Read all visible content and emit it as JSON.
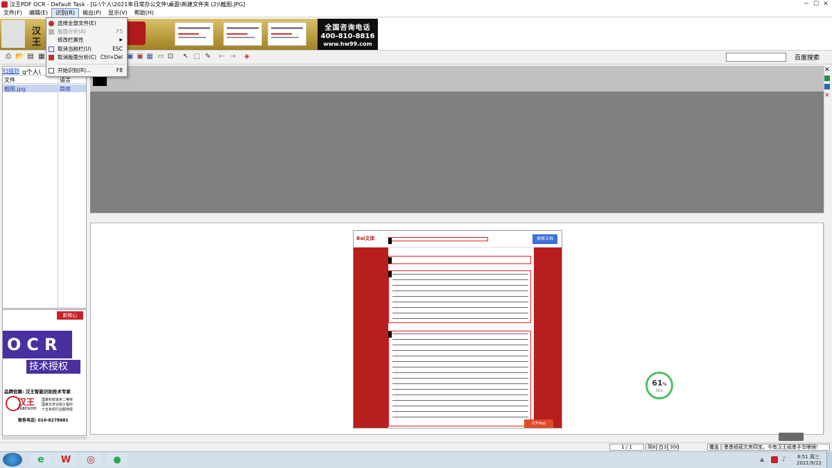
{
  "app": {
    "title": "汉王PDF OCR - Default Task - [G:\\个人\\2021年日常办公文件\\桌面\\新建文件夹 (2)\\截图.JPG]"
  },
  "menubar": {
    "file": "文件(F)",
    "edit": "编辑(E)",
    "recognize": "识别(R)",
    "output": "输出(P)",
    "display": "显示(V)",
    "help": "帮助(H)"
  },
  "banner": {
    "hotline_title": "全国咨询电话",
    "hotline_number": "400-810-8816",
    "website": "www.hw99.com",
    "brand_fragment_1": "汉",
    "brand_fragment_2": "王"
  },
  "recognize_menu": {
    "items": [
      {
        "label": "选择全部文件(E)",
        "shortcut": ""
      },
      {
        "label": "版面分析(A)",
        "shortcut": "F5"
      },
      {
        "label": "修改栏属性",
        "shortcut": "▶"
      },
      {
        "label": "取消当前栏(U)",
        "shortcut": "ESC"
      },
      {
        "label": "取消版面分析(C)",
        "shortcut": "Ctrl+Del"
      },
      {
        "label": "开始识别(R)...",
        "shortcut": "F8"
      }
    ]
  },
  "toolbar": {
    "search_label": "百度搜索"
  },
  "left_panel": {
    "scan_label": "扫描到",
    "task_name": "g个人\\",
    "col_file": "文件",
    "col_lang": "语言",
    "rows": [
      {
        "file": "截图.jpg",
        "lang": "简体"
      }
    ]
  },
  "left_ad": {
    "badge": "新核心",
    "ocr": "OCR",
    "tech": "技术授权",
    "credibility": "品牌信赖: 汉王智能识别技术专家",
    "logo_cn": "汉王",
    "logo_en": "Hanvon",
    "award1": "国家科技进步二等奖",
    "award2": "国家文字识别工程中",
    "award3": "十五年的行业服务经",
    "phone": "联系电话: 010-8278681"
  },
  "document": {
    "logo": "Bai文库",
    "search_button": "搜索文档",
    "open_app": "打开App"
  },
  "gauge": {
    "percent": "61",
    "percent_unit": "%",
    "speed": "0K/s",
    "fill_fraction": 0.61
  },
  "statusbar": {
    "page": "1 / 1",
    "w": "简6",
    "h": "白31",
    "dpi": "300",
    "mode": "覆盖",
    "ad": "墨墨纸砚文房四宝，今有汉王砚墨手写眼镜！"
  },
  "taskbar": {
    "time": "8:51 周三",
    "date": "2021/9/22"
  },
  "colors": {
    "accent_red": "#e02020",
    "gauge_green": "#4cc060",
    "selected_row": "#c8d4f0"
  }
}
